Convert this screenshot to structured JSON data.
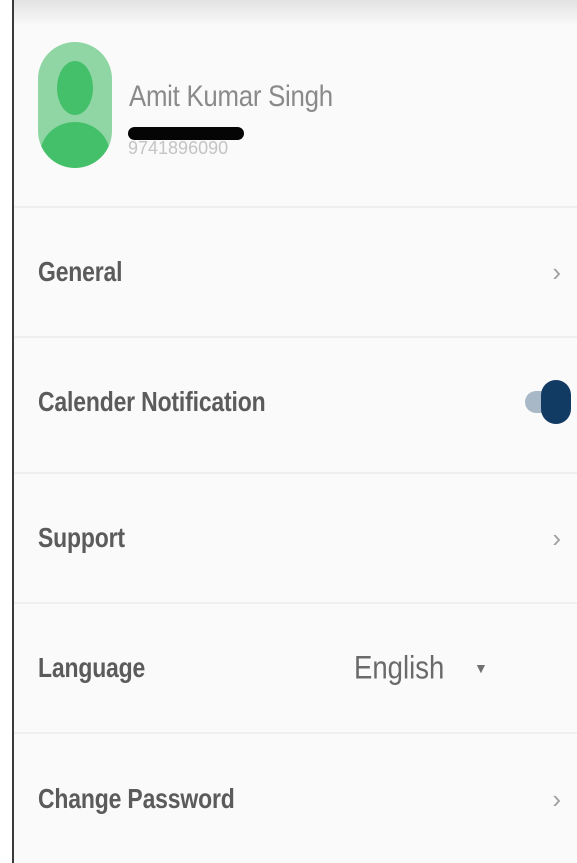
{
  "profile": {
    "name": "Amit Kumar Singh",
    "phone": "9741896090"
  },
  "menu": {
    "general": {
      "label": "General",
      "icon": "chevron-right-icon"
    },
    "calendar_notification": {
      "label": "Calender Notification",
      "toggle_on": true,
      "toggle_color": "#123b63"
    },
    "support": {
      "label": "Support",
      "icon": "chevron-right-icon"
    },
    "language": {
      "label": "Language",
      "value": "English",
      "icon": "dropdown-caret-icon"
    },
    "change_password": {
      "label": "Change Password",
      "icon": "chevron-right-icon"
    }
  },
  "glyphs": {
    "chevron": "›",
    "caret": "▼"
  },
  "colors": {
    "avatar_bg": "#8fd6a4",
    "avatar_figure": "#45c06a",
    "toggle_knob": "#123b63",
    "toggle_track": "#a9b8c6"
  }
}
